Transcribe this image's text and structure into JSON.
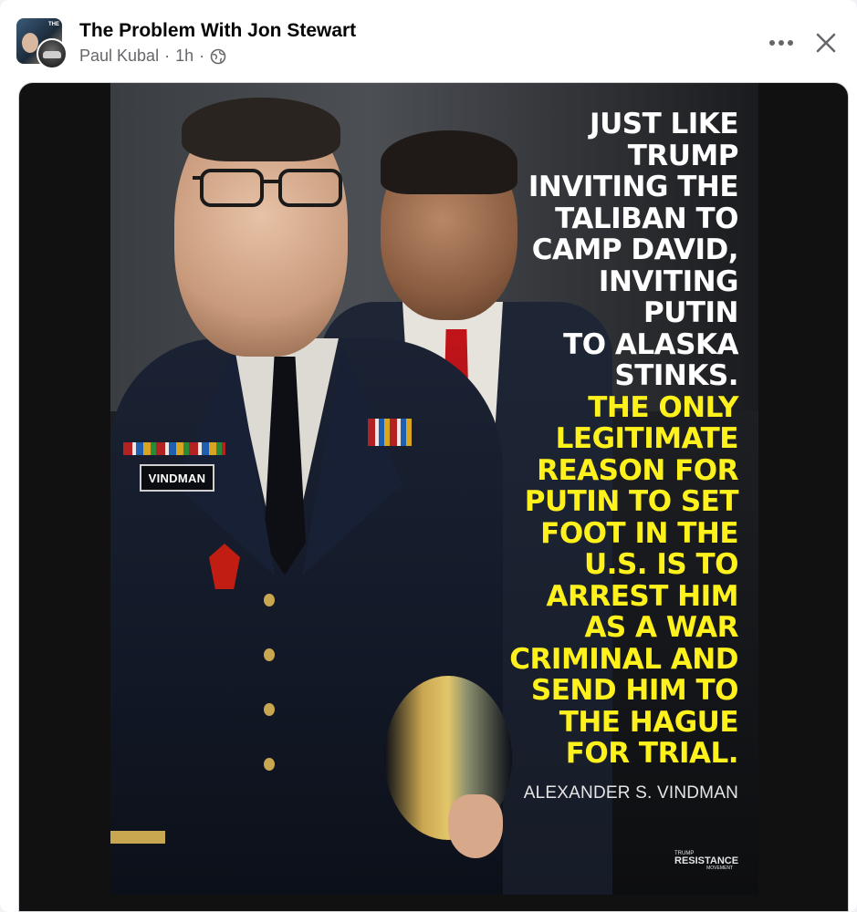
{
  "post": {
    "page_name": "The Problem With Jon Stewart",
    "author": "Paul Kubal",
    "time": "1h",
    "separator": "·",
    "audience_icon": "globe-icon",
    "more_icon": "more-horizontal-icon",
    "close_icon": "close-icon"
  },
  "image": {
    "quote_white_lines": [
      "JUST LIKE",
      "TRUMP",
      "INVITING THE",
      "TALIBAN TO",
      "CAMP DAVID,",
      "INVITING",
      "PUTIN",
      "TO ALASKA",
      "STINKS."
    ],
    "quote_yellow_lines": [
      "THE ONLY",
      "LEGITIMATE",
      "REASON FOR",
      "PUTIN TO SET",
      "FOOT IN THE",
      "U.S. IS TO",
      "ARREST HIM",
      "AS A WAR",
      "CRIMINAL AND",
      "SEND HIM TO",
      "THE HAGUE",
      "FOR TRIAL."
    ],
    "attribution": "ALEXANDER S. VINDMAN",
    "name_tag": "VINDMAN",
    "watermark": {
      "top": "TRUMP",
      "middle": "RESISTANCE",
      "bottom": "MOVEMENT"
    },
    "colors": {
      "white_text": "#ffffff",
      "yellow_text": "#fff21c"
    }
  }
}
